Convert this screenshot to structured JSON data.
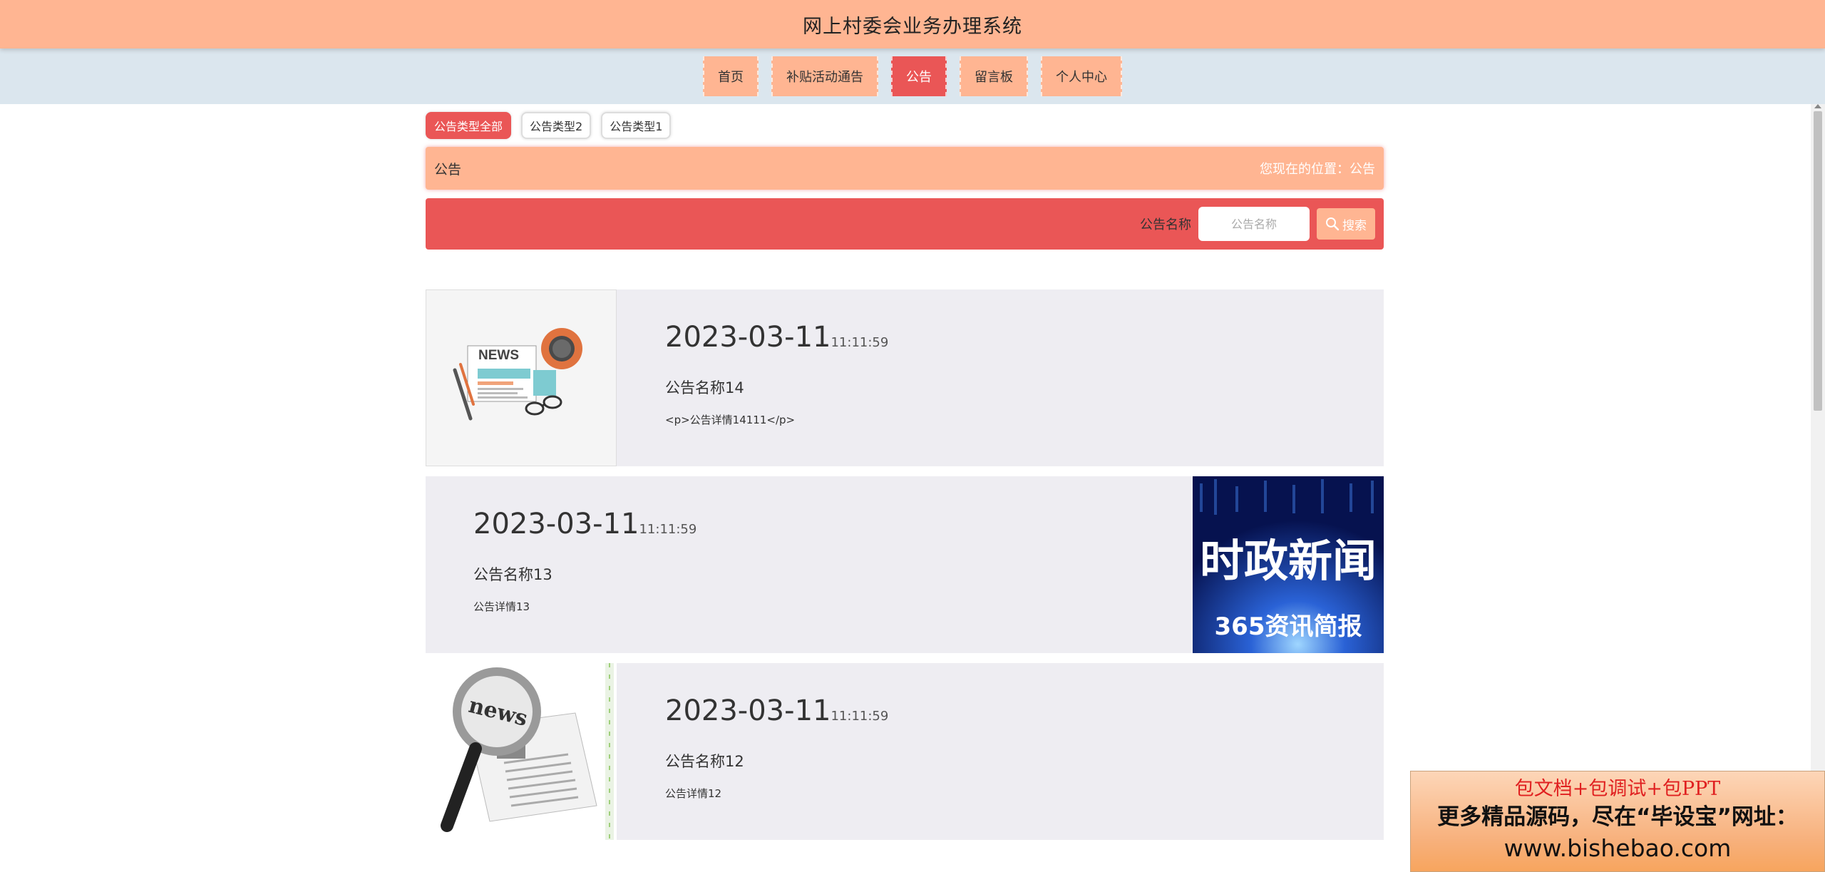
{
  "header": {
    "title": "网上村委会业务办理系统"
  },
  "nav": {
    "items": [
      {
        "label": "首页"
      },
      {
        "label": "补贴活动通告"
      },
      {
        "label": "公告"
      },
      {
        "label": "留言板"
      },
      {
        "label": "个人中心"
      }
    ],
    "active_index": 2
  },
  "type_filters": [
    {
      "label": "公告类型全部"
    },
    {
      "label": "公告类型2"
    },
    {
      "label": "公告类型1"
    }
  ],
  "breadcrumb": {
    "title": "公告",
    "location": "您现在的位置：公告"
  },
  "search": {
    "label": "公告名称",
    "placeholder": "公告名称",
    "button_label": "搜索"
  },
  "cards": [
    {
      "date": "2023-03-11",
      "time": "11:11:59",
      "title": "公告名称14",
      "desc": "<p>公告详情14111</p>",
      "image_side": "left"
    },
    {
      "date": "2023-03-11",
      "time": "11:11:59",
      "title": "公告名称13",
      "desc": "公告详情13",
      "image_side": "right",
      "image_text": {
        "headline": "时政新闻",
        "sub": "365资讯简报"
      }
    },
    {
      "date": "2023-03-11",
      "time": "11:11:59",
      "title": "公告名称12",
      "desc": "公告详情12",
      "image_side": "left",
      "image_text": {
        "word": "news"
      }
    }
  ],
  "thumb_news_word": "NEWS",
  "promo": {
    "line1": "包文档+包调试+包PPT",
    "line2": "更多精品源码，尽在“毕设宝”网址：",
    "line3": "www.bishebao.com"
  },
  "colors": {
    "accent_peach": "#ffb592",
    "accent_red": "#ea5656",
    "nav_bg": "#dbe6ee",
    "card_bg": "#eeedf2"
  }
}
